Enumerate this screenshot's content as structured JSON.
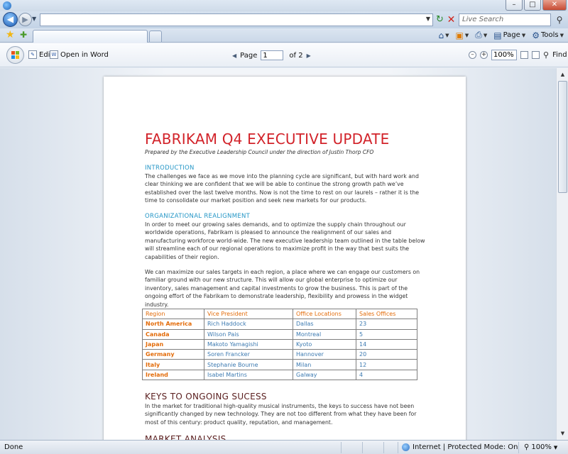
{
  "browser": {
    "search_placeholder": "Live Search",
    "commands": {
      "page": "Page",
      "tools": "Tools"
    }
  },
  "viewer": {
    "edit_label": "Edit",
    "open_in_word_label": "Open in Word",
    "page_label": "Page",
    "page_value": "1",
    "page_total": "of 2",
    "zoom_value": "100%",
    "find_label": "Find"
  },
  "document": {
    "title": "FABRIKAM Q4 EXECUTIVE UPDATE",
    "subtitle": "Prepared by the Executive Leadership Council under the direction of Justin Thorp CFO",
    "sections": [
      {
        "heading": "INTRODUCTION",
        "body": "The challenges we face as we move into the planning cycle are significant, but with hard work and clear thinking we are confident that we will be able to continue the strong growth path we’ve established over the last twelve months.  Now is not the time to rest on our laurels – rather it is the time to consolidate our market position and seek new markets for our products."
      },
      {
        "heading": "ORGANIZATIONAL REALIGNMENT",
        "body": "In order to meet our growing sales demands, and to optimize the supply chain throughout our worldwide operations, Fabrikam is pleased to announce the realignment of our sales and manufacturing workforce world-wide. The new executive leadership team outlined in the table below will streamline each of our regional operations to maximize profit in the way that best suits the capabilities of their region.",
        "body2": "We can maximize our sales targets in each region, a place where we can engage our customers on familiar ground with our new structure. This will allow our global enterprise to optimize our inventory, sales management and capital investments to grow the business. This is part of the ongoing effort of the Fabrikam to demonstrate leadership, flexibility and prowess in the widget industry."
      }
    ],
    "table": {
      "headers": [
        "Region",
        "Vice President",
        "Office Locations",
        "Sales Offices"
      ],
      "rows": [
        [
          "North America",
          "Rich Haddock",
          "Dallas",
          "23"
        ],
        [
          "Canada",
          "Wilson Pais",
          "Montreal",
          "5"
        ],
        [
          "Japan",
          "Makoto Yamagishi",
          "Kyoto",
          "14"
        ],
        [
          "Germany",
          "Soren Francker",
          "Hannover",
          "20"
        ],
        [
          "Italy",
          "Stephanie Bourne",
          "Milan",
          "12"
        ],
        [
          "Ireland",
          "Isabel Martins",
          "Galway",
          "4"
        ]
      ]
    },
    "keys": {
      "heading": "KEYS TO ONGOING SUCESS",
      "body": "In the market for traditional high-quality musical instruments, the keys to success have not been significantly changed by new technology.  They are not too different from what they have been for most of this century: product quality, reputation, and management."
    },
    "market": {
      "heading": "MARKET ANALYSIS"
    }
  },
  "status": {
    "left": "Done",
    "zone": "Internet | Protected Mode: On",
    "zoom": "100%"
  },
  "colors": {
    "title_red": "#d2232a",
    "heading_blue": "#2496c6",
    "table_orange": "#e36c0a",
    "table_blue": "#3c7ab1",
    "big_heading": "#5a1e1e"
  },
  "icons": [
    "ie-icon",
    "back-icon",
    "forward-icon",
    "refresh-icon",
    "stop-icon",
    "search-icon",
    "favorites-star-icon",
    "add-favorites-icon",
    "home-icon",
    "feeds-icon",
    "print-icon",
    "page-icon",
    "tools-gear-icon",
    "office-button-icon",
    "edit-icon",
    "word-icon",
    "zoom-out-icon",
    "zoom-in-icon",
    "find-icon",
    "globe-icon"
  ]
}
